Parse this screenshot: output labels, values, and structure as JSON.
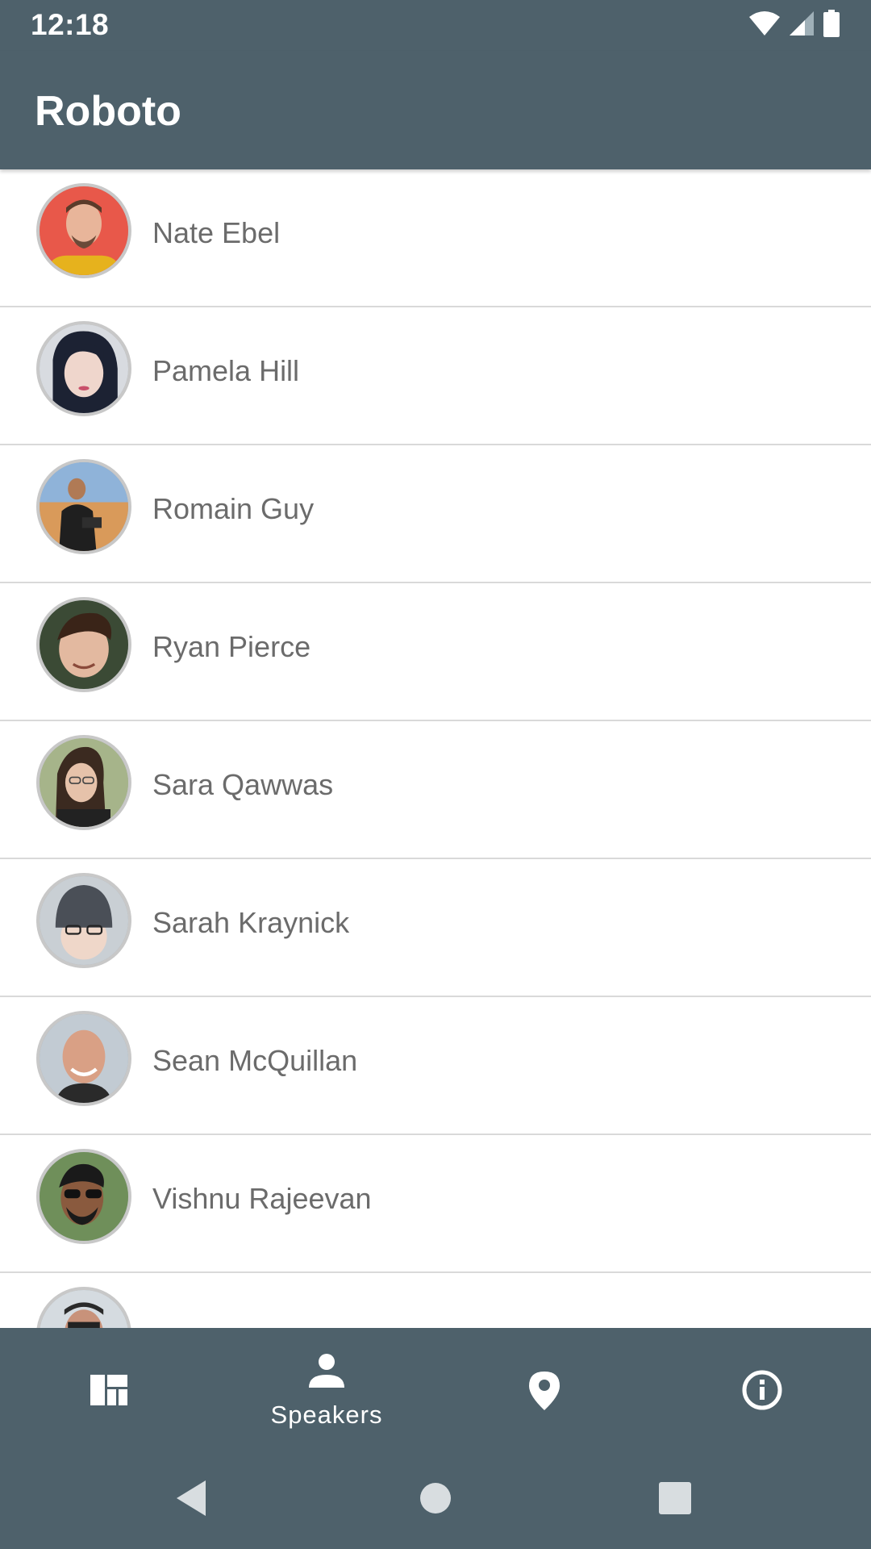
{
  "status_bar": {
    "time": "12:18",
    "icons": [
      "wifi-icon",
      "cell-signal-icon",
      "battery-icon"
    ]
  },
  "app_bar": {
    "title": "Roboto"
  },
  "speakers": [
    {
      "name": "Nate Ebel"
    },
    {
      "name": "Pamela Hill"
    },
    {
      "name": "Romain Guy"
    },
    {
      "name": "Ryan Pierce"
    },
    {
      "name": "Sara Qawwas"
    },
    {
      "name": "Sarah Kraynick"
    },
    {
      "name": "Sean McQuillan"
    },
    {
      "name": "Vishnu Rajeevan"
    },
    {
      "name": ""
    }
  ],
  "bottom_nav": {
    "items": [
      {
        "icon": "dashboard-icon",
        "label": ""
      },
      {
        "icon": "person-icon",
        "label": "Speakers",
        "active": true
      },
      {
        "icon": "location-pin-icon",
        "label": ""
      },
      {
        "icon": "info-icon",
        "label": ""
      }
    ]
  },
  "system_nav": {
    "buttons": [
      "back-icon",
      "home-icon",
      "recents-icon"
    ]
  },
  "colors": {
    "primary": "#4e616b",
    "text": "#6b6b6b",
    "divider": "#d9d9d9",
    "on_primary": "#ffffff"
  }
}
